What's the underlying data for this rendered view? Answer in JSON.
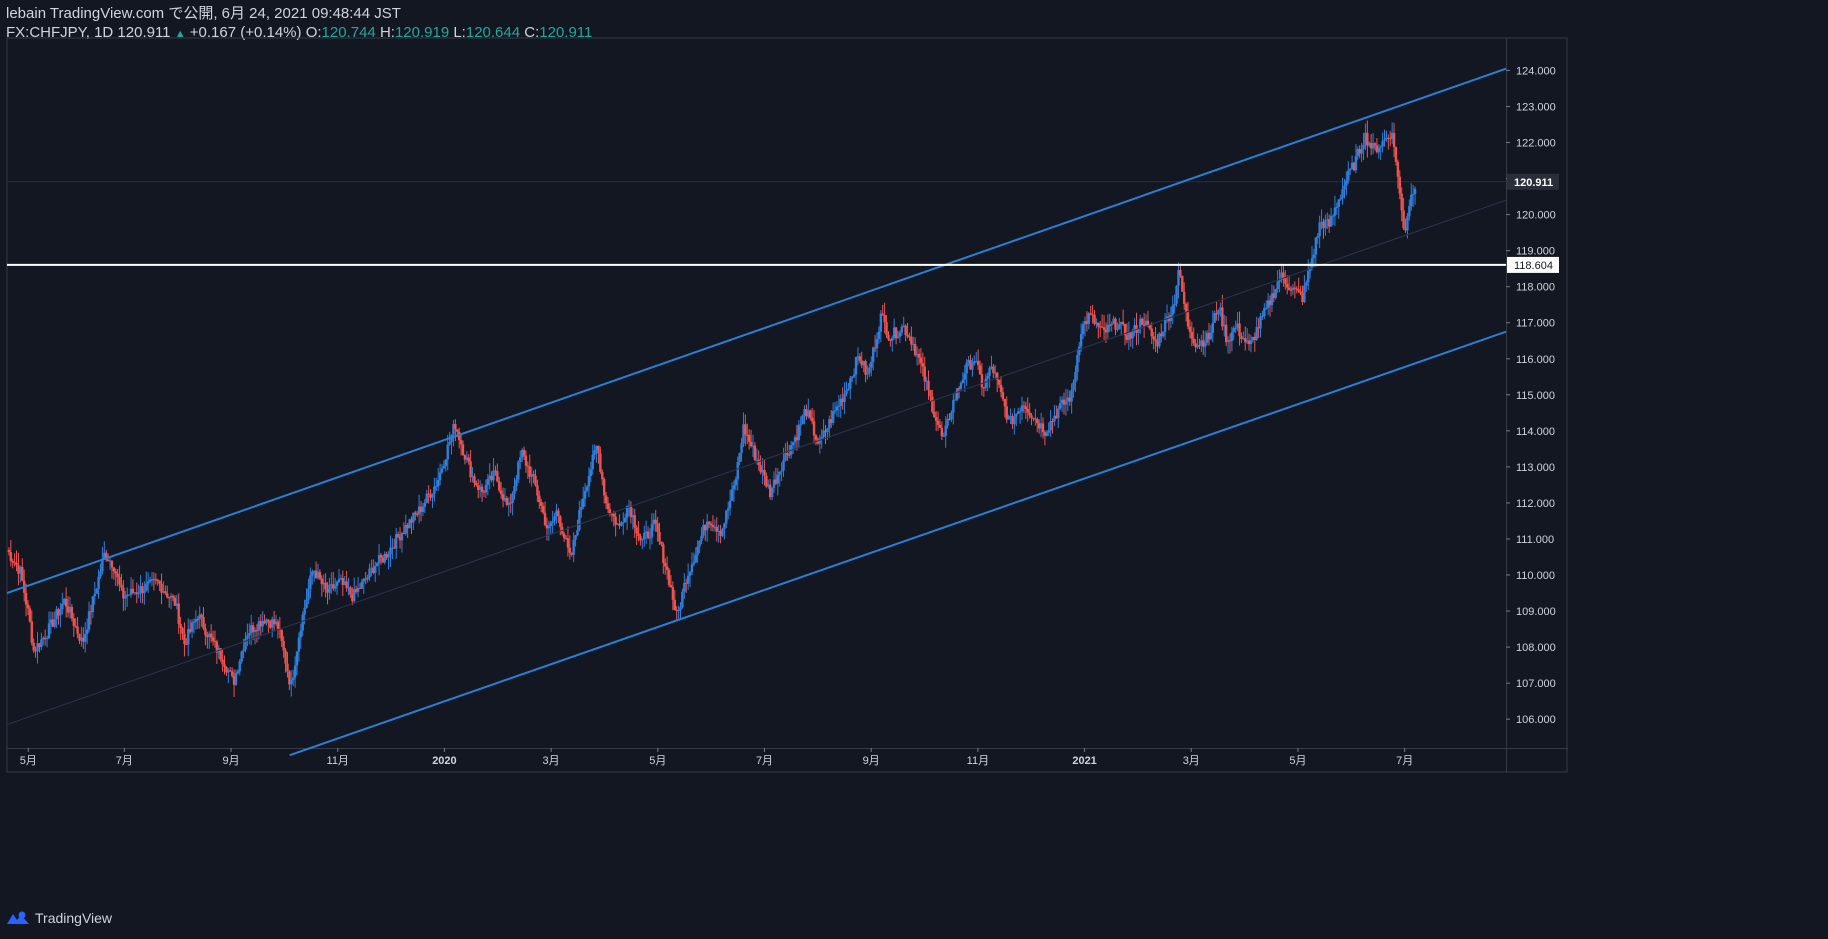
{
  "header": {
    "line1": "lebain TradingView.com で公開, 6月 24, 2021 09:48:44 JST",
    "symbol": "FX:CHFJPY, 1D 120.911",
    "change_arrow": "▲",
    "change": "+0.167 (+0.14%)",
    "o_label": "O:",
    "o_val": "120.744",
    "h_label": "H:",
    "h_val": "120.919",
    "l_label": "L:",
    "l_val": "120.644",
    "c_label": "C:",
    "c_val": "120.911"
  },
  "footer": {
    "brand": "TradingView",
    "logo_icon": "tradingview-logo-icon"
  },
  "colors": {
    "background": "#131722",
    "up": "#2f7fdc",
    "down": "#ef5350",
    "channel": "#2a7fd4",
    "horizontal": "#ffffff",
    "value_green": "#26a69a"
  },
  "chart_data": {
    "type": "candlestick",
    "symbol": "FX:CHFJPY",
    "interval": "1D",
    "last_price": 120.911,
    "last_price_label": "120.911",
    "horizontal_line": {
      "value": 118.604,
      "label": "118.604"
    },
    "ylim": [
      105.2,
      124.9
    ],
    "y_ticks": [
      106,
      107,
      108,
      109,
      110,
      111,
      112,
      113,
      114,
      115,
      116,
      117,
      118,
      119,
      120,
      121,
      122,
      123,
      124
    ],
    "y_tick_labels": [
      "106.000",
      "107.000",
      "108.000",
      "109.000",
      "110.000",
      "111.000",
      "112.000",
      "113.000",
      "114.000",
      "115.000",
      "116.000",
      "117.000",
      "118.000",
      "119.000",
      "120.000",
      "121.000",
      "122.000",
      "123.000",
      "124.000"
    ],
    "x_ticks": [
      {
        "label": "5月",
        "t": 0.05,
        "bold": false
      },
      {
        "label": "7月",
        "t": 0.95,
        "bold": false
      },
      {
        "label": "9月",
        "t": 1.95,
        "bold": false
      },
      {
        "label": "11月",
        "t": 2.95,
        "bold": false
      },
      {
        "label": "2020",
        "t": 3.95,
        "bold": true
      },
      {
        "label": "3月",
        "t": 4.95,
        "bold": false
      },
      {
        "label": "5月",
        "t": 5.95,
        "bold": false
      },
      {
        "label": "7月",
        "t": 6.95,
        "bold": false
      },
      {
        "label": "9月",
        "t": 7.95,
        "bold": false
      },
      {
        "label": "11月",
        "t": 8.95,
        "bold": false
      },
      {
        "label": "2021",
        "t": 9.95,
        "bold": true
      },
      {
        "label": "3月",
        "t": 10.95,
        "bold": false
      },
      {
        "label": "5月",
        "t": 11.95,
        "bold": false
      },
      {
        "label": "7月",
        "t": 12.95,
        "bold": false
      }
    ],
    "x_range": [
      -0.15,
      13.9
    ],
    "channel_lines": [
      {
        "name": "upper",
        "p1": [
          -0.15,
          109.5
        ],
        "p2": [
          13.9,
          124.05
        ]
      },
      {
        "name": "lower",
        "p1": [
          2.5,
          105.0
        ],
        "p2": [
          13.9,
          116.75
        ]
      },
      {
        "name": "median",
        "p1": [
          -0.15,
          105.85
        ],
        "p2": [
          13.9,
          120.4
        ],
        "faint": true
      }
    ],
    "price_path": [
      [
        -0.15,
        110.7
      ],
      [
        0.0,
        110.1
      ],
      [
        0.1,
        108.8
      ],
      [
        0.15,
        107.9
      ],
      [
        0.3,
        108.4
      ],
      [
        0.5,
        109.3
      ],
      [
        0.7,
        108.1
      ],
      [
        0.85,
        109.6
      ],
      [
        0.95,
        110.6
      ],
      [
        1.05,
        110.3
      ],
      [
        1.15,
        109.4
      ],
      [
        1.35,
        109.6
      ],
      [
        1.55,
        109.8
      ],
      [
        1.75,
        109.2
      ],
      [
        1.85,
        108.1
      ],
      [
        2.0,
        108.9
      ],
      [
        2.15,
        108.2
      ],
      [
        2.3,
        107.6
      ],
      [
        2.4,
        107.0
      ],
      [
        2.55,
        108.4
      ],
      [
        2.75,
        108.8
      ],
      [
        2.9,
        108.6
      ],
      [
        3.0,
        107.5
      ],
      [
        3.05,
        106.9
      ],
      [
        3.15,
        108.5
      ],
      [
        3.3,
        110.2
      ],
      [
        3.45,
        109.5
      ],
      [
        3.6,
        109.8
      ],
      [
        3.75,
        109.4
      ],
      [
        3.9,
        109.9
      ],
      [
        4.0,
        110.3
      ],
      [
        4.1,
        110.5
      ],
      [
        4.3,
        111.2
      ],
      [
        4.5,
        111.8
      ],
      [
        4.7,
        112.6
      ],
      [
        4.9,
        114.2
      ],
      [
        5.0,
        113.4
      ],
      [
        5.1,
        112.7
      ],
      [
        5.2,
        112.3
      ],
      [
        5.35,
        112.8
      ],
      [
        5.5,
        111.8
      ],
      [
        5.65,
        113.4
      ],
      [
        5.8,
        112.5
      ],
      [
        5.95,
        111.2
      ],
      [
        6.05,
        111.8
      ],
      [
        6.2,
        110.4
      ],
      [
        6.35,
        112.3
      ],
      [
        6.5,
        113.6
      ],
      [
        6.6,
        112.0
      ],
      [
        6.75,
        111.3
      ],
      [
        6.85,
        112.0
      ],
      [
        7.0,
        110.9
      ],
      [
        7.15,
        111.4
      ],
      [
        7.3,
        110.0
      ],
      [
        7.4,
        108.8
      ],
      [
        7.5,
        109.9
      ],
      [
        7.65,
        110.9
      ],
      [
        7.75,
        111.6
      ],
      [
        7.9,
        111.2
      ],
      [
        8.05,
        112.5
      ],
      [
        8.15,
        114.1
      ],
      [
        8.3,
        113.2
      ],
      [
        8.45,
        112.3
      ],
      [
        8.6,
        113.2
      ],
      [
        8.75,
        113.9
      ],
      [
        8.85,
        114.6
      ],
      [
        9.0,
        113.6
      ],
      [
        9.15,
        114.4
      ],
      [
        9.3,
        115.1
      ],
      [
        9.45,
        116.1
      ],
      [
        9.55,
        115.5
      ],
      [
        9.7,
        117.2
      ],
      [
        9.8,
        116.6
      ],
      [
        9.95,
        116.9
      ],
      [
        10.05,
        116.5
      ],
      [
        10.15,
        115.8
      ],
      [
        10.3,
        114.5
      ],
      [
        10.4,
        113.7
      ],
      [
        10.5,
        114.7
      ],
      [
        10.65,
        115.7
      ],
      [
        10.75,
        116.0
      ],
      [
        10.85,
        115.2
      ],
      [
        10.95,
        115.8
      ],
      [
        11.05,
        115.0
      ],
      [
        11.15,
        114.2
      ],
      [
        11.3,
        114.8
      ],
      [
        11.45,
        114.3
      ],
      [
        11.55,
        114.0
      ],
      [
        11.7,
        114.6
      ],
      [
        11.85,
        115.0
      ],
      [
        11.95,
        116.8
      ],
      [
        12.05,
        117.2
      ],
      [
        12.2,
        116.7
      ],
      [
        12.35,
        117.0
      ],
      [
        12.5,
        116.6
      ],
      [
        12.65,
        117.1
      ],
      [
        12.8,
        116.4
      ],
      [
        12.9,
        117.0
      ],
      [
        13.0,
        117.5
      ],
      [
        13.05,
        118.5
      ],
      [
        13.15,
        117.0
      ],
      [
        13.25,
        116.4
      ],
      [
        13.4,
        116.6
      ],
      [
        13.5,
        117.5
      ],
      [
        13.6,
        116.5
      ],
      [
        13.7,
        116.9
      ],
      [
        13.85,
        116.3
      ],
      [
        13.95,
        116.9
      ],
      [
        14.05,
        117.4
      ],
      [
        14.2,
        118.3
      ],
      [
        14.35,
        117.9
      ],
      [
        14.45,
        117.7
      ],
      [
        14.55,
        118.7
      ],
      [
        14.65,
        119.8
      ],
      [
        14.75,
        119.7
      ],
      [
        14.85,
        120.4
      ],
      [
        14.95,
        121.0
      ],
      [
        15.05,
        121.5
      ],
      [
        15.15,
        122.2
      ],
      [
        15.25,
        121.8
      ],
      [
        15.35,
        122.0
      ],
      [
        15.45,
        122.3
      ],
      [
        15.5,
        121.6
      ],
      [
        15.55,
        120.4
      ],
      [
        15.6,
        119.5
      ],
      [
        15.65,
        120.3
      ],
      [
        15.72,
        120.911
      ]
    ]
  }
}
